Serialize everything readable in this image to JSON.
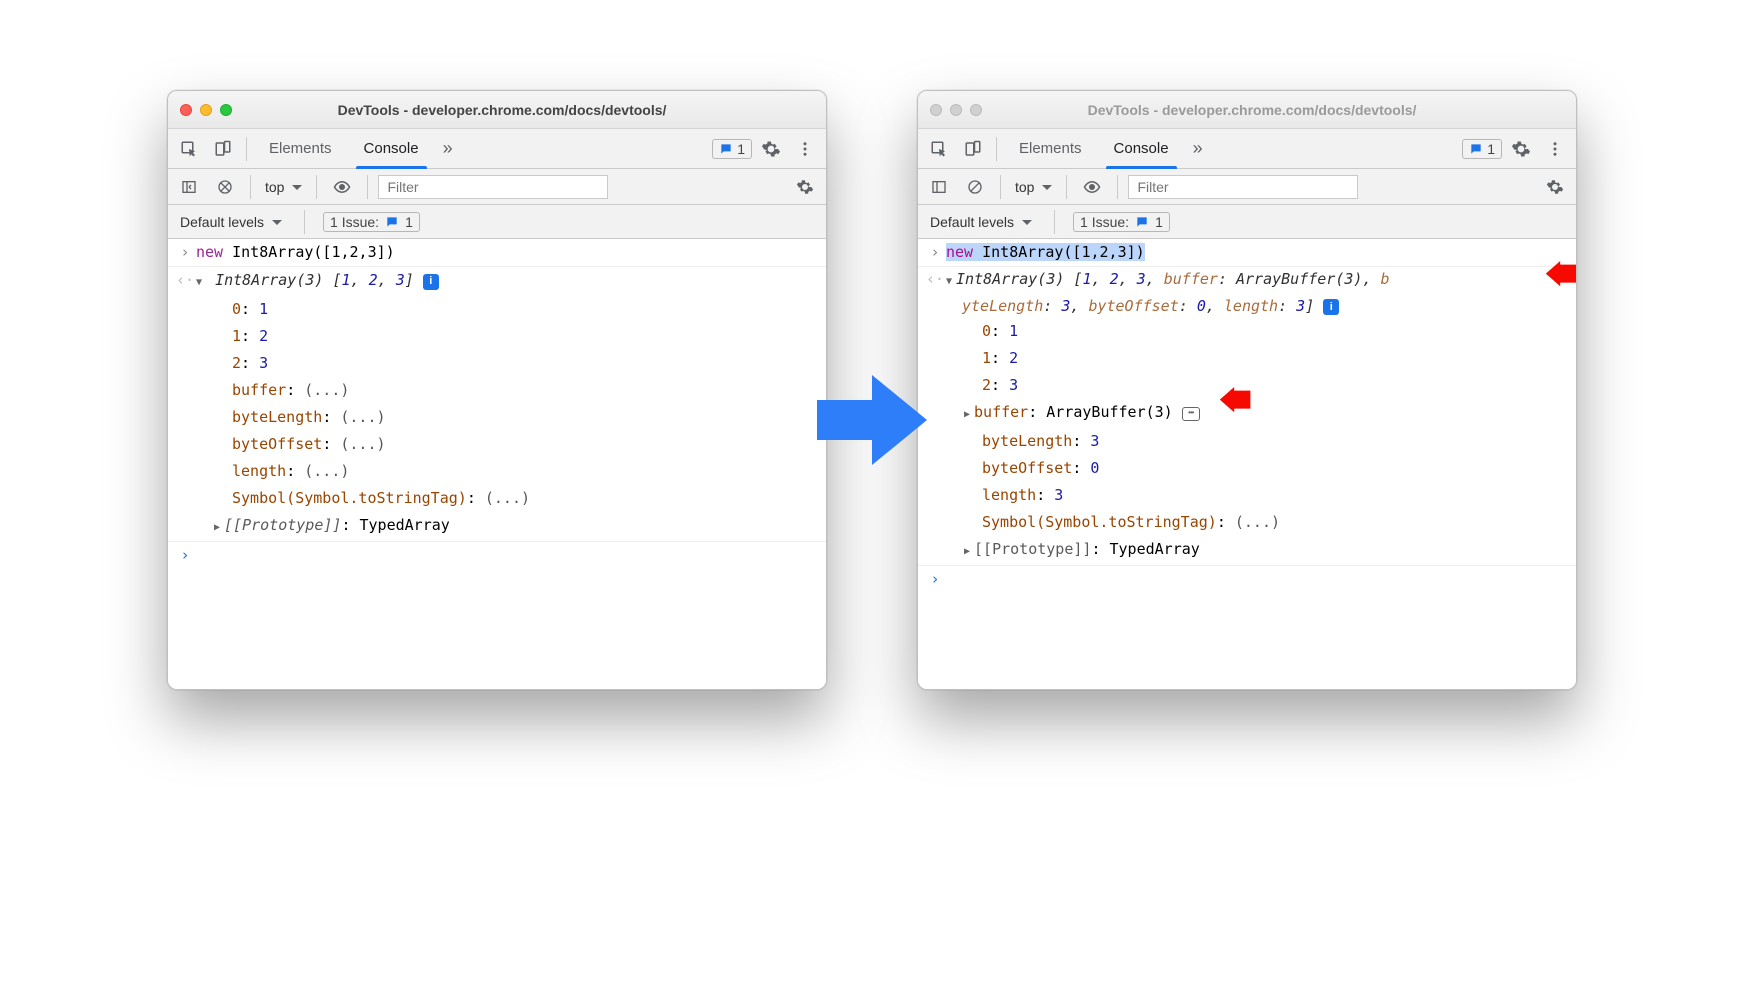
{
  "windows": {
    "left": {
      "title": "DevTools - developer.chrome.com/docs/devtools/",
      "active": true
    },
    "right": {
      "title": "DevTools - developer.chrome.com/docs/devtools/",
      "active": false
    }
  },
  "tabs": {
    "elements": "Elements",
    "console": "Console",
    "moreGlyph": "»"
  },
  "msgBadge": "1",
  "toolbar": {
    "contextLabel": "top",
    "filterPlaceholder": "Filter"
  },
  "subbar": {
    "levels": "Default levels",
    "issuesLabel": "1 Issue:",
    "issuesCount": "1"
  },
  "consoleLeft": {
    "input": {
      "kw": "new",
      "call": " Int8Array([1,2,3])"
    },
    "header": {
      "type": "Int8Array(3)",
      "arr": " [1, 2, 3]"
    },
    "props": [
      {
        "k": "0",
        "v": "1"
      },
      {
        "k": "1",
        "v": "2"
      },
      {
        "k": "2",
        "v": "3"
      },
      {
        "k": "buffer",
        "v": "(...)"
      },
      {
        "k": "byteLength",
        "v": "(...)"
      },
      {
        "k": "byteOffset",
        "v": "(...)"
      },
      {
        "k": "length",
        "v": "(...)"
      },
      {
        "k": "Symbol(Symbol.toStringTag)",
        "v": "(...)"
      }
    ],
    "proto": {
      "k": "[[Prototype]]",
      "v": "TypedArray"
    }
  },
  "consoleRight": {
    "input": {
      "kw": "new",
      "call": " Int8Array([1,2,3])"
    },
    "headerFull": {
      "type": "Int8Array(3)",
      "line1a": " [1, 2, 3, ",
      "bufK": "buffer",
      "bufV": "ArrayBuffer(3)",
      "tail1": ", b",
      "line2a": "yteLength",
      "v2": "3",
      "line2b": ", byteOffset",
      "v3": "0",
      "line2c": ", length",
      "v4": "3",
      "close": "]"
    },
    "props": [
      {
        "k": "0",
        "v": "1"
      },
      {
        "k": "1",
        "v": "2"
      },
      {
        "k": "2",
        "v": "3"
      }
    ],
    "buffer": {
      "k": "buffer",
      "v": "ArrayBuffer(3)"
    },
    "evals": [
      {
        "k": "byteLength",
        "v": "3"
      },
      {
        "k": "byteOffset",
        "v": "0"
      },
      {
        "k": "length",
        "v": "3"
      },
      {
        "k": "Symbol(Symbol.toStringTag)",
        "v": "(...)"
      }
    ],
    "proto": {
      "k": "[[Prototype]]",
      "v": "TypedArray"
    }
  }
}
